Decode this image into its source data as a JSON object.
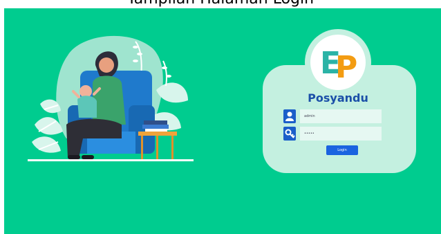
{
  "header": {
    "caption": "Tampilan Halaman Login"
  },
  "brand": {
    "name": "Posyandu",
    "logo_letter_e": "E",
    "logo_letter_p": "P"
  },
  "form": {
    "username_value": "admin",
    "password_value": "•••••",
    "login_label": "Login"
  },
  "colors": {
    "background": "#00cc8f",
    "card": "#c4f0e0",
    "brand_text": "#1b4fa8",
    "accent_blue": "#1a63e0",
    "logo_teal": "#2bb3a6",
    "logo_orange": "#f39c12"
  },
  "icons": {
    "username": "user-icon",
    "password": "key-icon"
  }
}
